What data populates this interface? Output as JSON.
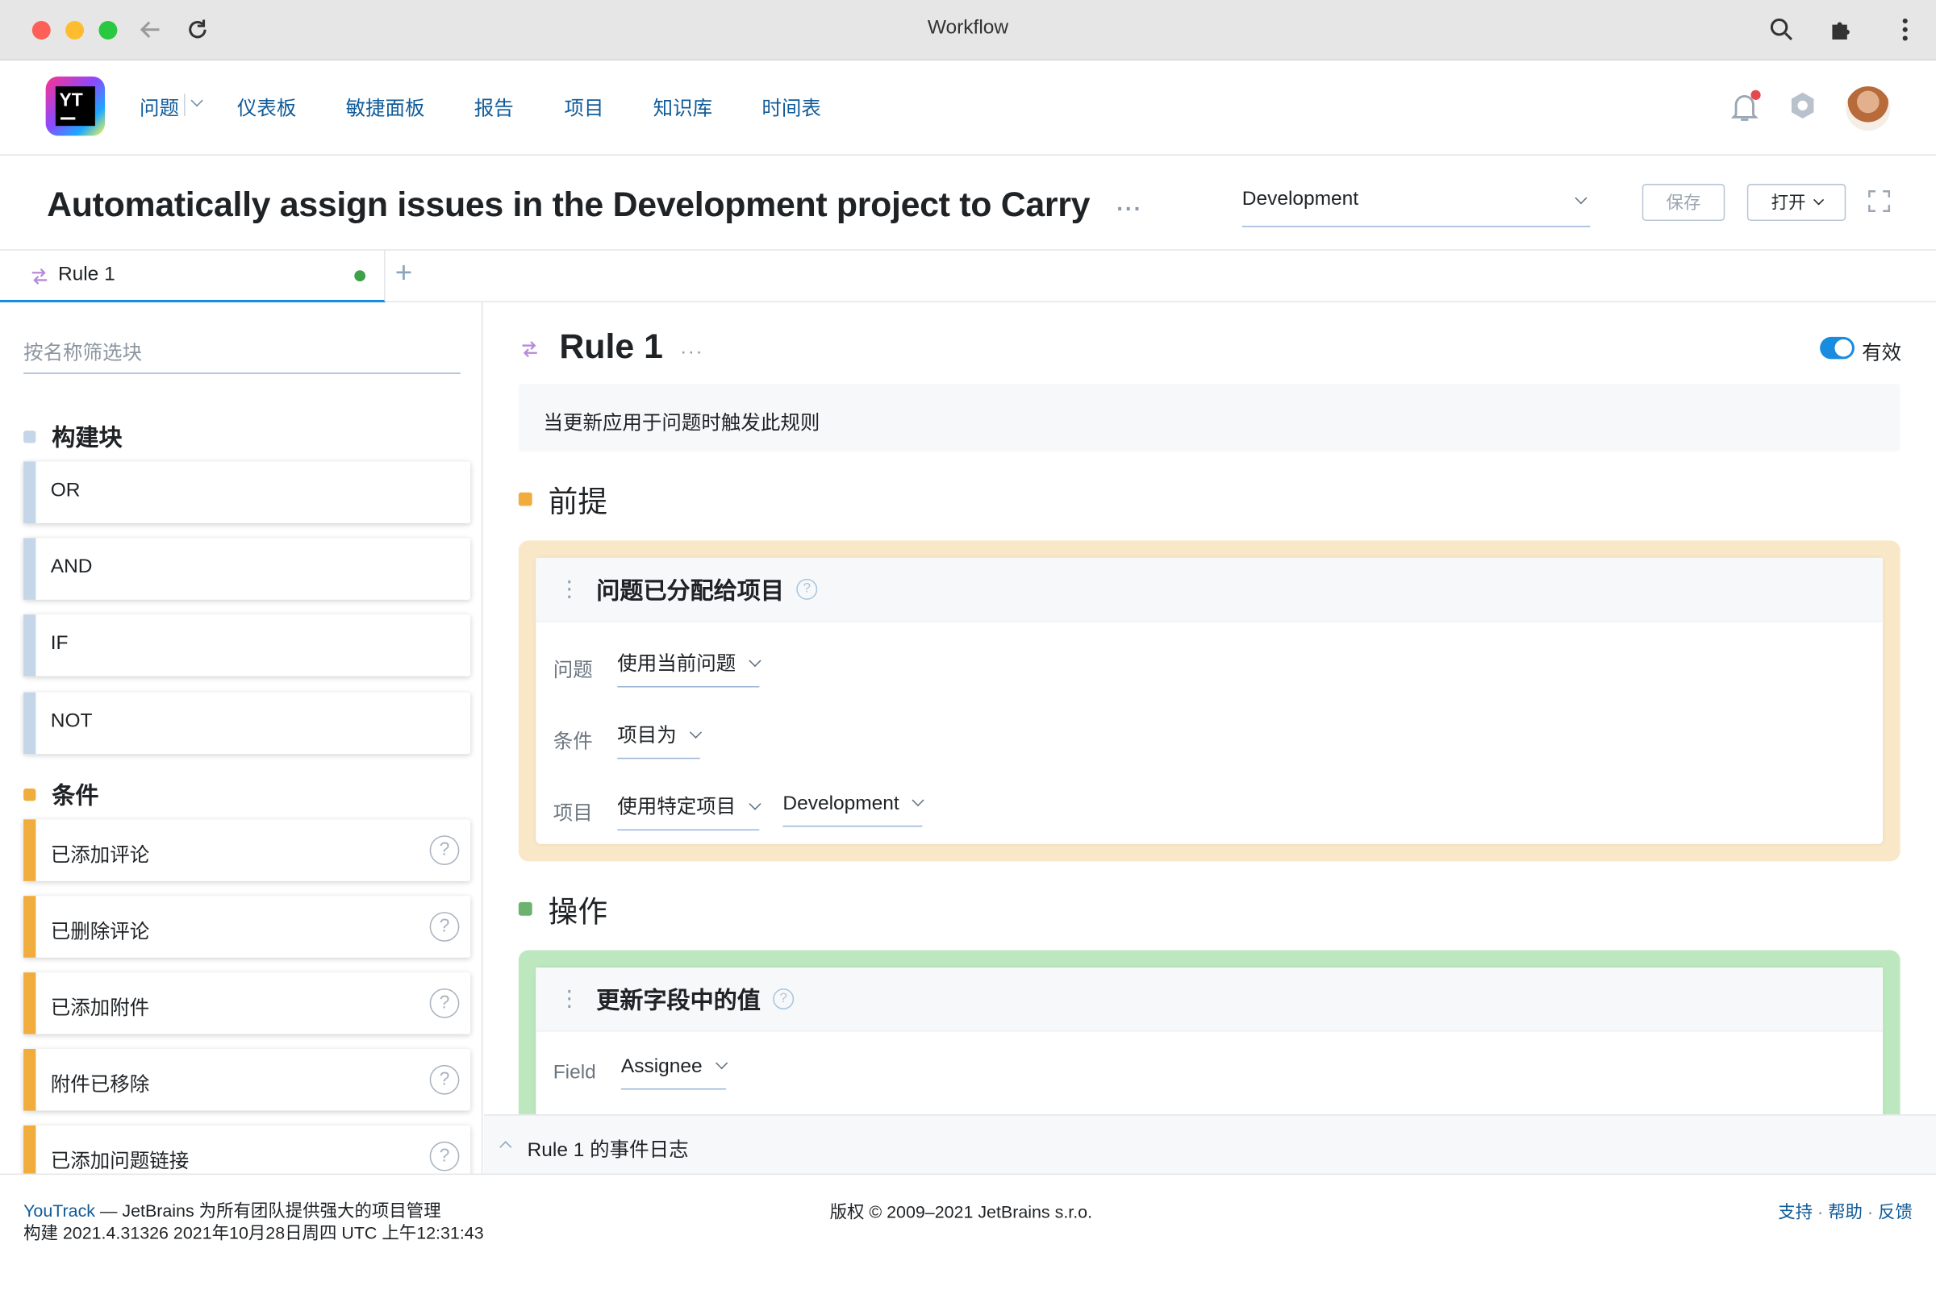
{
  "window": {
    "title": "Workflow"
  },
  "nav": {
    "logo_text": "YT",
    "links": [
      "问题",
      "仪表板",
      "敏捷面板",
      "报告",
      "项目",
      "知识库",
      "时间表"
    ]
  },
  "header": {
    "title": "Automatically assign issues in the Development project to Carry",
    "project": "Development",
    "save_label": "保存",
    "open_label": "打开"
  },
  "tabs": [
    {
      "label": "Rule 1",
      "status_color": "#3fa04a"
    }
  ],
  "sidebar": {
    "filter_placeholder": "按名称筛选块",
    "sections": [
      {
        "title": "构建块",
        "color": "#c5d6e8",
        "items": [
          "OR",
          "AND",
          "IF",
          "NOT"
        ]
      },
      {
        "title": "条件",
        "color": "#f0ad3e",
        "items": [
          "已添加评论",
          "已删除评论",
          "已添加附件",
          "附件已移除",
          "已添加问题链接"
        ]
      }
    ]
  },
  "rule": {
    "title": "Rule 1",
    "enabled_label": "有效",
    "description": "当更新应用于问题时触发此规则",
    "prerequisites": {
      "title": "前提",
      "card_title": "问题已分配给项目",
      "rows": [
        {
          "key": "问题",
          "values": [
            "使用当前问题"
          ]
        },
        {
          "key": "条件",
          "values": [
            "项目为"
          ]
        },
        {
          "key": "项目",
          "values": [
            "使用特定项目",
            "Development"
          ]
        }
      ]
    },
    "actions": {
      "title": "操作",
      "card_title": "更新字段中的值",
      "rows": [
        {
          "key": "Field",
          "values": [
            "Assignee"
          ]
        }
      ]
    }
  },
  "event_log": {
    "label": "Rule 1 的事件日志"
  },
  "footer": {
    "brand": "YouTrack",
    "tagline": " — JetBrains 为所有团队提供强大的项目管理",
    "build": "构建 2021.4.31326 2021年10月28日周四 UTC 上午12:31:43",
    "copyright": "版权 © 2009–2021 JetBrains s.r.o.",
    "links": [
      "支持",
      "帮助",
      "反馈"
    ]
  }
}
